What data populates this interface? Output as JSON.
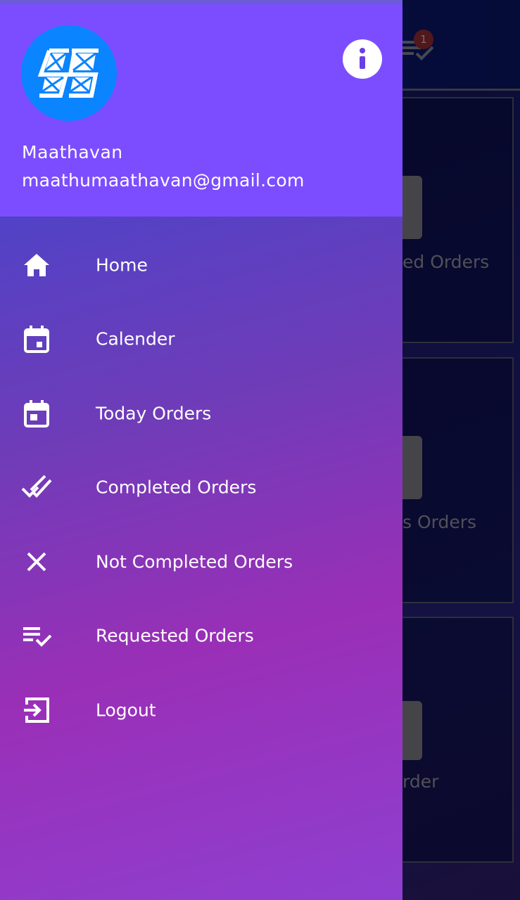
{
  "background": {
    "notification_count": "1",
    "cards": [
      {
        "label": "ed Orders"
      },
      {
        "label": "s Orders"
      },
      {
        "label": "rder"
      }
    ]
  },
  "drawer": {
    "user_name": "Maathavan",
    "user_email": "maathumaathavan@gmail.com",
    "avatar_icon": "app-logo-icon",
    "info_icon": "info-icon",
    "menu": [
      {
        "label": "Home",
        "icon": "home-icon"
      },
      {
        "label": "Calender",
        "icon": "calendar-icon"
      },
      {
        "label": "Today Orders",
        "icon": "calendar-today-icon"
      },
      {
        "label": "Completed Orders",
        "icon": "double-check-icon"
      },
      {
        "label": "Not Completed Orders",
        "icon": "close-icon"
      },
      {
        "label": "Requested Orders",
        "icon": "playlist-check-icon"
      },
      {
        "label": "Logout",
        "icon": "logout-icon"
      }
    ]
  },
  "colors": {
    "header": "#7c4dff",
    "avatar": "#0a84ff",
    "text": "#ffffff"
  }
}
